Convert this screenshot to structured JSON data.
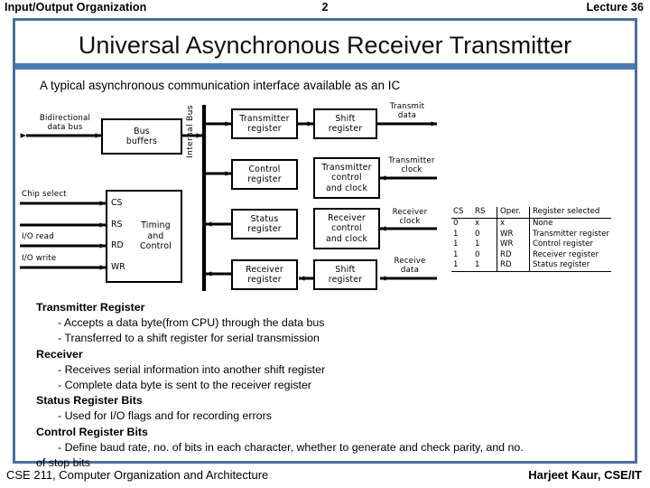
{
  "header": {
    "left": "Input/Output Organization",
    "center": "2",
    "right": "Lecture 36"
  },
  "slide": {
    "title": "Universal Asynchronous Receiver Transmitter",
    "subtitle": "A typical asynchronous communication interface available as an IC"
  },
  "diagram": {
    "boxes": [
      {
        "key": "bus_buffers",
        "label": "Bus\nbuffers"
      },
      {
        "key": "timing_control",
        "label": "Timing\nand\nControl"
      },
      {
        "key": "transmitter_register",
        "label": "Transmitter\nregister"
      },
      {
        "key": "shift_register_tx",
        "label": "Shift\nregister"
      },
      {
        "key": "control_register",
        "label": "Control\nregister"
      },
      {
        "key": "transmitter_control_clock",
        "label": "Transmitter\ncontrol\nand clock"
      },
      {
        "key": "status_register",
        "label": "Status\nregister"
      },
      {
        "key": "receiver_control_clock",
        "label": "Receiver\ncontrol\nand clock"
      },
      {
        "key": "receiver_register",
        "label": "Receiver\nregister"
      },
      {
        "key": "shift_register_rx",
        "label": "Shift\nregister"
      }
    ],
    "box_labels": {
      "bus_buffers": "Bus buffers",
      "timing_control": "Timing and Control",
      "transmitter_register": "Transmitter register",
      "shift_register_tx": "Shift register",
      "control_register": "Control register",
      "transmitter_control_clock": "Transmitter control and clock",
      "status_register": "Status register",
      "receiver_control_clock": "Receiver control and clock",
      "receiver_register": "Receiver register",
      "shift_register_rx": "Shift register"
    },
    "signal_labels": {
      "bidirectional_data_bus": "Bidirectional\ndata bus",
      "chip_select": "Chip select",
      "io_read": "I/O read",
      "io_write": "I/O write",
      "internal_bus": "Internal Bus",
      "transmit_data": "Transmit\ndata",
      "transmitter_clock": "Transmitter\nclock",
      "receiver_clock": "Receiver\nclock",
      "receive_data": "Receive\ndata"
    },
    "pins": [
      "CS",
      "RS",
      "RD",
      "WR"
    ]
  },
  "register_table": {
    "columns": [
      "CS",
      "RS",
      "Oper.",
      "Register selected"
    ],
    "rows": [
      [
        "0",
        "x",
        "x",
        "None"
      ],
      [
        "1",
        "0",
        "WR",
        "Transmitter register"
      ],
      [
        "1",
        "1",
        "WR",
        "Control register"
      ],
      [
        "1",
        "0",
        "RD",
        "Receiver register"
      ],
      [
        "1",
        "1",
        "RD",
        "Status register"
      ]
    ]
  },
  "bullets": [
    {
      "style": "head",
      "text": "Transmitter Register"
    },
    {
      "style": "sub",
      "text": "- Accepts a data byte(from CPU) through the data bus"
    },
    {
      "style": "sub",
      "text": "- Transferred to a shift register for serial transmission"
    },
    {
      "style": "head",
      "text": "Receiver"
    },
    {
      "style": "sub",
      "text": "- Receives serial information into another shift register"
    },
    {
      "style": "sub",
      "text": "- Complete data byte is sent to the receiver register"
    },
    {
      "style": "head",
      "text": "Status Register Bits"
    },
    {
      "style": "sub",
      "text": "- Used for I/O flags and for recording errors"
    },
    {
      "style": "head",
      "text": "Control Register Bits"
    },
    {
      "style": "sub",
      "text": "- Define baud rate, no. of bits in each character, whether to generate and check parity, and no."
    },
    {
      "style": "cont",
      "text": "of stop bits"
    }
  ],
  "footer": {
    "left": "CSE 211, Computer Organization and Architecture",
    "right": "Harjeet Kaur, CSE/IT"
  },
  "colors": {
    "frame": "#4a6f9c",
    "accent_bar": "#4a7ab5"
  }
}
